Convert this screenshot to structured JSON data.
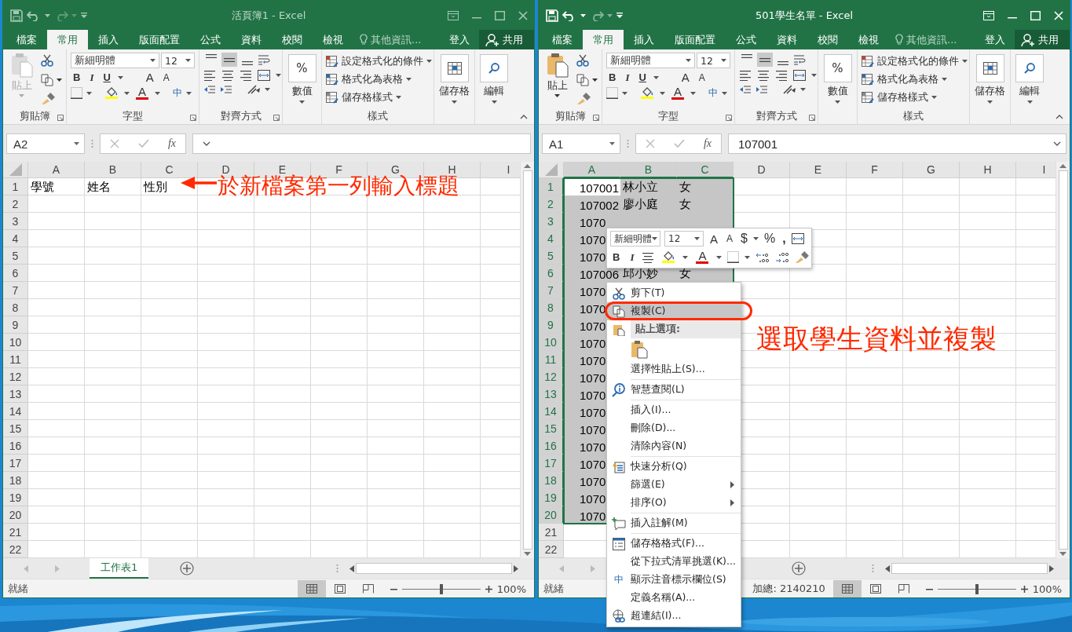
{
  "windows": [
    {
      "active": false,
      "title": "活頁簿1 - Excel",
      "tabs": [
        {
          "label": "檔案",
          "selected": false
        },
        {
          "label": "常用",
          "selected": true
        },
        {
          "label": "插入",
          "selected": false
        },
        {
          "label": "版面配置",
          "selected": false
        },
        {
          "label": "公式",
          "selected": false
        },
        {
          "label": "資料",
          "selected": false
        },
        {
          "label": "校閱",
          "selected": false
        },
        {
          "label": "檢視",
          "selected": false
        }
      ],
      "tell_me": "其他資訊...",
      "sign_in": "登入",
      "share": "共用",
      "ribbon": {
        "paste": {
          "label": "貼上",
          "disabled": true
        },
        "font_name": "新細明體",
        "font_size": "12",
        "bold": "B",
        "italic": "I",
        "underline": "U",
        "grow_font": "A",
        "shrink_font": "A",
        "font_color": "A",
        "phonetic": "中",
        "vertical_align": [
          {
            "selected": false
          },
          {
            "selected": true
          },
          {
            "selected": false
          }
        ],
        "percent": "%",
        "number": "數值",
        "styles": [
          "設定格式化的條件",
          "格式化為表格",
          "儲存格樣式"
        ],
        "cells": "儲存格",
        "editing": "編輯",
        "groups": [
          "剪貼簿",
          "字型",
          "對齊方式",
          "樣式"
        ]
      },
      "name_box": "A2",
      "fx": "fx",
      "sheet": {
        "columns": [
          {
            "label": "A",
            "selected": false
          },
          {
            "label": "B",
            "selected": false
          },
          {
            "label": "C",
            "selected": false
          },
          {
            "label": "D",
            "selected": false
          },
          {
            "label": "E",
            "selected": false
          },
          {
            "label": "F",
            "selected": false
          },
          {
            "label": "G",
            "selected": false
          },
          {
            "label": "H",
            "selected": false
          },
          {
            "label": "I",
            "selected": false
          }
        ],
        "rows": [
          {
            "label": "1",
            "selected": false,
            "cells": [
              "學號",
              "姓名",
              "性別"
            ]
          },
          {
            "label": "2",
            "selected": false
          },
          {
            "label": "3",
            "selected": false
          },
          {
            "label": "4",
            "selected": false
          },
          {
            "label": "5",
            "selected": false
          },
          {
            "label": "6",
            "selected": false
          },
          {
            "label": "7",
            "selected": false
          },
          {
            "label": "8",
            "selected": false
          },
          {
            "label": "9",
            "selected": false
          },
          {
            "label": "10",
            "selected": false
          },
          {
            "label": "11",
            "selected": false
          },
          {
            "label": "12",
            "selected": false
          },
          {
            "label": "13",
            "selected": false
          },
          {
            "label": "14",
            "selected": false
          },
          {
            "label": "15",
            "selected": false
          },
          {
            "label": "16",
            "selected": false
          },
          {
            "label": "17",
            "selected": false
          },
          {
            "label": "18",
            "selected": false
          },
          {
            "label": "19",
            "selected": false
          },
          {
            "label": "20",
            "selected": false
          },
          {
            "label": "21",
            "selected": false
          },
          {
            "label": "22",
            "selected": false
          }
        ]
      },
      "sheet_tabs": [
        {
          "label": "工作表1",
          "selected": true
        }
      ],
      "status": "就緒",
      "views": [
        {
          "kind": "normal",
          "selected": true
        },
        {
          "kind": "page_layout",
          "selected": false
        },
        {
          "kind": "page_break",
          "selected": false
        }
      ],
      "zoom": {
        "level": 0.5,
        "reading": "100%"
      }
    },
    {
      "active": true,
      "title": "501學生名單 - Excel",
      "tabs": [
        {
          "label": "檔案",
          "selected": false
        },
        {
          "label": "常用",
          "selected": true
        },
        {
          "label": "插入",
          "selected": false
        },
        {
          "label": "版面配置",
          "selected": false
        },
        {
          "label": "公式",
          "selected": false
        },
        {
          "label": "資料",
          "selected": false
        },
        {
          "label": "校閱",
          "selected": false
        },
        {
          "label": "檢視",
          "selected": false
        }
      ],
      "tell_me": "其他資訊...",
      "sign_in": "登入",
      "share": "共用",
      "ribbon": {
        "paste": {
          "label": "貼上",
          "disabled": false
        },
        "font_name": "新細明體",
        "font_size": "12",
        "bold": "B",
        "italic": "I",
        "underline": "U",
        "grow_font": "A",
        "shrink_font": "A",
        "font_color": "A",
        "phonetic": "中",
        "vertical_align": [
          {
            "selected": false
          },
          {
            "selected": true
          },
          {
            "selected": false
          }
        ],
        "percent": "%",
        "number": "數值",
        "styles": [
          "設定格式化的條件",
          "格式化為表格",
          "儲存格樣式"
        ],
        "cells": "儲存格",
        "editing": "編輯",
        "groups": [
          "剪貼簿",
          "字型",
          "對齊方式",
          "樣式"
        ]
      },
      "name_box": "A1",
      "fx": "fx",
      "formula": "107001",
      "sheet": {
        "columns": [
          {
            "label": "A",
            "selected": true,
            "right_aligned": true
          },
          {
            "label": "B",
            "selected": true
          },
          {
            "label": "C",
            "selected": true
          },
          {
            "label": "D",
            "selected": false
          },
          {
            "label": "E",
            "selected": false
          },
          {
            "label": "F",
            "selected": false
          },
          {
            "label": "G",
            "selected": false
          },
          {
            "label": "H",
            "selected": false
          },
          {
            "label": "I",
            "selected": false
          }
        ],
        "rows": [
          {
            "label": "1",
            "selected": true,
            "cells": [
              "107001",
              "林小立",
              "女"
            ]
          },
          {
            "label": "2",
            "selected": true,
            "cells": [
              "107002",
              "廖小庭",
              "女"
            ]
          },
          {
            "label": "3",
            "selected": true,
            "cells": [
              "1070"
            ]
          },
          {
            "label": "4",
            "selected": true,
            "cells": [
              "1070"
            ]
          },
          {
            "label": "5",
            "selected": true,
            "cells": [
              "1070"
            ]
          },
          {
            "label": "6",
            "selected": true,
            "cells": [
              "107006",
              "邱小妙",
              "女"
            ]
          },
          {
            "label": "7",
            "selected": true,
            "cells": [
              "1070"
            ]
          },
          {
            "label": "8",
            "selected": true,
            "cells": [
              "1070"
            ]
          },
          {
            "label": "9",
            "selected": true,
            "cells": [
              "1070"
            ]
          },
          {
            "label": "10",
            "selected": true,
            "cells": [
              "1070"
            ]
          },
          {
            "label": "11",
            "selected": true,
            "cells": [
              "1070"
            ]
          },
          {
            "label": "12",
            "selected": true,
            "cells": [
              "1070"
            ]
          },
          {
            "label": "13",
            "selected": true,
            "cells": [
              "1070"
            ]
          },
          {
            "label": "14",
            "selected": true,
            "cells": [
              "1070"
            ]
          },
          {
            "label": "15",
            "selected": true,
            "cells": [
              "1070"
            ]
          },
          {
            "label": "16",
            "selected": true,
            "cells": [
              "1070"
            ]
          },
          {
            "label": "17",
            "selected": true,
            "cells": [
              "1070"
            ]
          },
          {
            "label": "18",
            "selected": true,
            "cells": [
              "1070"
            ]
          },
          {
            "label": "19",
            "selected": true,
            "cells": [
              "1070"
            ]
          },
          {
            "label": "20",
            "selected": true,
            "cells": [
              "1070"
            ]
          },
          {
            "label": "21",
            "selected": false
          },
          {
            "label": "22",
            "selected": false
          }
        ]
      },
      "status": "就緒",
      "sum": "加總: 2140210",
      "views": [
        {
          "kind": "normal",
          "selected": true
        },
        {
          "kind": "page_layout",
          "selected": false
        },
        {
          "kind": "page_break",
          "selected": false
        }
      ],
      "zoom": {
        "level": 0.5,
        "reading": "100%"
      }
    }
  ],
  "mini_toolbar": {
    "font_name": "新細明體",
    "font_size": "12",
    "grow_font": "A",
    "shrink_font": "A",
    "currency": "$",
    "percent": "%",
    "comma": ",",
    "bold": "B",
    "italic": "I",
    "font_color": "A"
  },
  "context_menu": {
    "items": [
      {
        "kind": "command",
        "label": "剪下(T)",
        "selected": false
      },
      {
        "kind": "command",
        "label": "複製(C)",
        "selected": true
      },
      {
        "kind": "header",
        "label": "貼上選項:"
      },
      {
        "kind": "paste_options"
      },
      {
        "kind": "command",
        "label": "選擇性貼上(S)...",
        "selected": false
      },
      {
        "kind": "separator"
      },
      {
        "kind": "command",
        "label": "智慧查閱(L)",
        "selected": false
      },
      {
        "kind": "separator"
      },
      {
        "kind": "command",
        "label": "插入(I)...",
        "selected": false
      },
      {
        "kind": "command",
        "label": "刪除(D)...",
        "selected": false
      },
      {
        "kind": "command",
        "label": "清除內容(N)",
        "selected": false
      },
      {
        "kind": "separator"
      },
      {
        "kind": "command",
        "label": "快速分析(Q)",
        "selected": false
      },
      {
        "kind": "submenu",
        "label": "篩選(E)",
        "selected": false
      },
      {
        "kind": "submenu",
        "label": "排序(O)",
        "selected": false
      },
      {
        "kind": "separator"
      },
      {
        "kind": "command",
        "label": "插入註解(M)",
        "selected": false
      },
      {
        "kind": "separator"
      },
      {
        "kind": "command",
        "label": "儲存格格式(F)...",
        "selected": false
      },
      {
        "kind": "command",
        "label": "從下拉式清單挑選(K)...",
        "selected": false
      },
      {
        "kind": "command",
        "label": "顯示注音標示欄位(S)",
        "selected": false,
        "icon_text": "中"
      },
      {
        "kind": "command",
        "label": "定義名稱(A)...",
        "selected": false
      },
      {
        "kind": "command",
        "label": "超連結(I)...",
        "selected": false
      }
    ]
  },
  "annotations": [
    {
      "kind": "arrow_note",
      "text": "於新檔案第一列輸入標題"
    },
    {
      "kind": "note",
      "text": "選取學生資料並複製"
    }
  ]
}
